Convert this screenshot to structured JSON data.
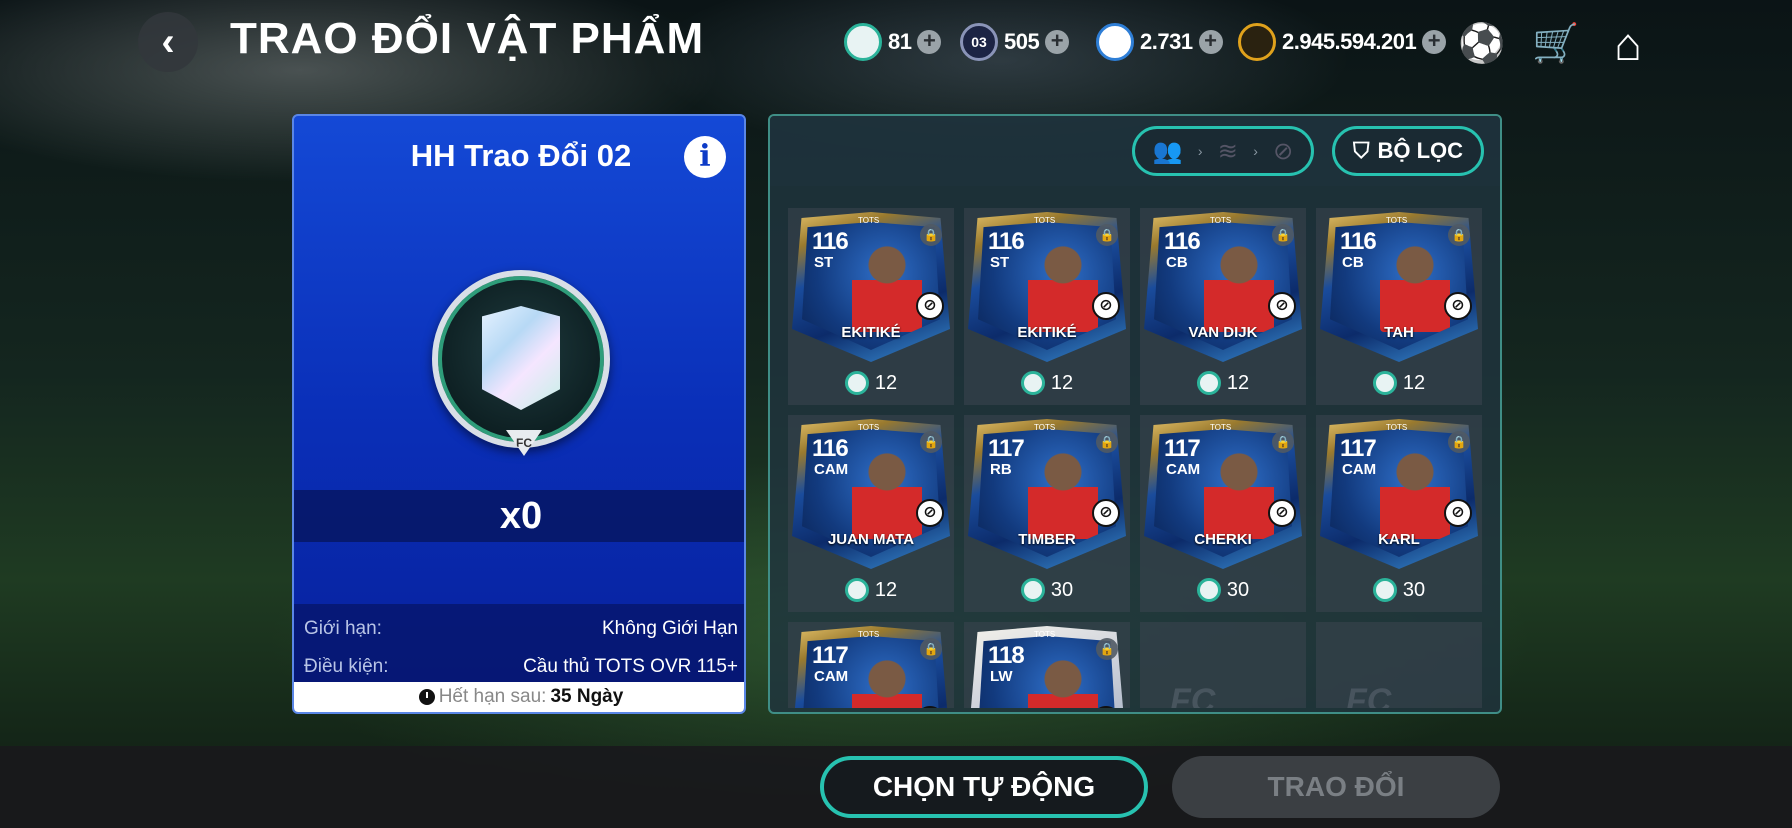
{
  "header": {
    "back_icon": "‹",
    "title": "TRAO ĐỔI VẬT PHẨM",
    "currencies": [
      {
        "icon": "shield-token",
        "value": "81",
        "color": "#2bb39a"
      },
      {
        "icon": "03",
        "value": "505",
        "color": "#8a94b8"
      },
      {
        "icon": "player-coin",
        "value": "2.731",
        "color": "#2e7ed6"
      },
      {
        "icon": "fc",
        "value": "2.945.594.201",
        "color": "#e0a21c"
      }
    ],
    "plus_label": "+",
    "icons": {
      "ball": "⚽",
      "cart": "🛒",
      "home": "⌂"
    }
  },
  "left": {
    "title": "HH Trao Đổi 02",
    "info_label": "i",
    "logo_text": "FC",
    "count": "x0",
    "limit_key": "Giới hạn:",
    "limit_val": "Không Giới Hạn",
    "cond_key": "Điều kiện:",
    "cond_val": "Cầu thủ TOTS OVR 115+",
    "expire_key": "Hết hạn sau:",
    "expire_val": "35 Ngày"
  },
  "right": {
    "filter_label": "BỘ LỌC",
    "filter_icon": "⛉",
    "chain": [
      "👥",
      "›",
      "≋",
      "›",
      "⊘"
    ],
    "empty_logo": "FC",
    "cards": [
      {
        "ovr": "116",
        "pos": "ST",
        "name": "EKITIKÉ",
        "cost": "12"
      },
      {
        "ovr": "116",
        "pos": "ST",
        "name": "EKITIKÉ",
        "cost": "12"
      },
      {
        "ovr": "116",
        "pos": "CB",
        "name": "VAN DIJK",
        "cost": "12"
      },
      {
        "ovr": "116",
        "pos": "CB",
        "name": "TAH",
        "cost": "12"
      },
      {
        "ovr": "116",
        "pos": "CAM",
        "name": "JUAN MATA",
        "cost": "12"
      },
      {
        "ovr": "117",
        "pos": "RB",
        "name": "TIMBER",
        "cost": "30"
      },
      {
        "ovr": "117",
        "pos": "CAM",
        "name": "CHERKI",
        "cost": "30"
      },
      {
        "ovr": "117",
        "pos": "CAM",
        "name": "KARL",
        "cost": "30"
      },
      {
        "ovr": "117",
        "pos": "CAM",
        "name": "",
        "cost": ""
      },
      {
        "ovr": "118",
        "pos": "LW",
        "name": "",
        "cost": ""
      }
    ],
    "card_tag": "TOTS",
    "lock_icon": "🔒",
    "notrade_icon": "⊘"
  },
  "footer": {
    "auto_label": "CHỌN TỰ ĐỘNG",
    "trade_label": "TRAO ĐỔI"
  }
}
